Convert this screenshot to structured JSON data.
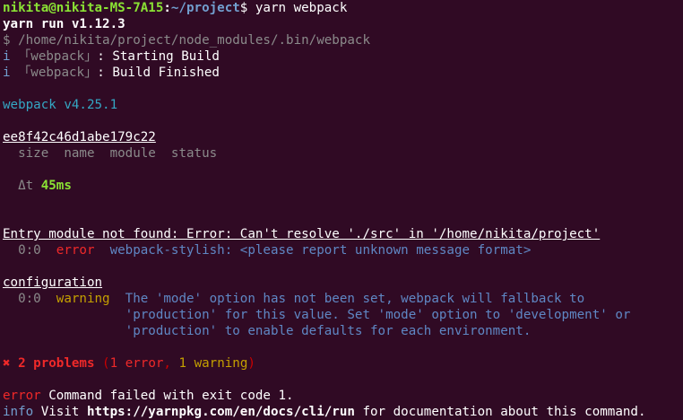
{
  "prompt": {
    "user_host": "nikita@nikita-MS-7A15",
    "sep": ":",
    "path": "~/project",
    "symbol": "$",
    "command": " yarn webpack"
  },
  "lines": {
    "yarn_run": "yarn run v1.12.3",
    "bin_path": "$ /home/nikita/project/node_modules/.bin/webpack",
    "info_icon": "i",
    "webpack_tag": "「webpack」",
    "starting": ": Starting Build",
    "finished": ": Build Finished",
    "webpack_version": "webpack v4.25.1",
    "hash": "ee8f42c46d1abe179c22",
    "table_header": "  size  name  module  status",
    "delta_symbol": "  Δt ",
    "delta_value": "45ms",
    "entry_error": "Entry module not found: Error: Can't resolve './src' in '/home/nikita/project'",
    "err_pos": "  0:0  ",
    "err_level": "error",
    "err_msg": "  webpack-stylish: <please report unknown message format>",
    "configuration": "configuration",
    "warn_pos": "  0:0  ",
    "warn_level": "warning",
    "warn_msg_1": "  The 'mode' option has not been set, webpack will fallback to",
    "warn_msg_2": "                'production' for this value. Set 'mode' option to 'development' or",
    "warn_msg_3": "                'production' to enable defaults for each environment.",
    "x_icon": "✖",
    "problems": " 2 problems",
    "paren_open": " (",
    "errors_count": "1 error",
    "comma": ", ",
    "warnings_count": "1 warning",
    "paren_close": ")",
    "error_label": "error",
    "failed": " Command failed with exit code 1.",
    "info_label": "info",
    "visit": " Visit ",
    "url": "https://yarnpkg.com/en/docs/cli/run",
    "doc_suffix": " for documentation about this command."
  },
  "colors": {
    "background": "#300a24",
    "prompt_user": "#8ae234",
    "prompt_path": "#729fcf",
    "version": "#34a7c4",
    "error": "#ef2929",
    "warning": "#c4a000"
  }
}
